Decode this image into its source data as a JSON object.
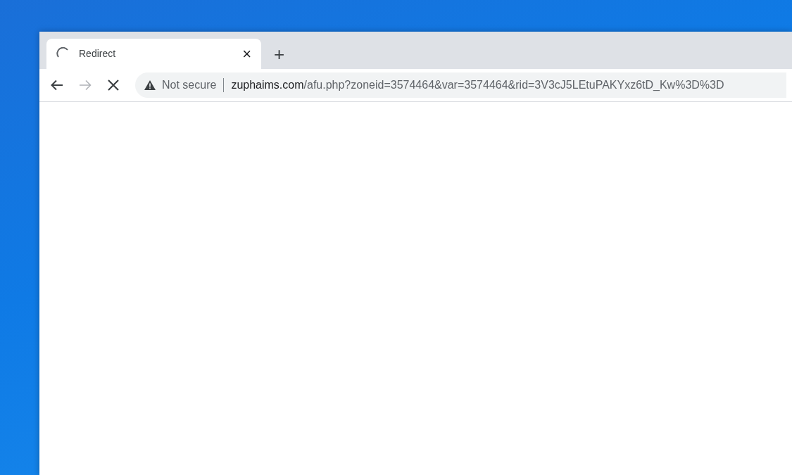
{
  "tabs": [
    {
      "title": "Redirect",
      "selected": true,
      "loading": true,
      "close": "×"
    }
  ],
  "new_tab": "+",
  "toolbar": {
    "back_disabled": false,
    "forward_disabled": true,
    "loading": true
  },
  "address_bar": {
    "security": "Not secure",
    "url_host": "zuphaims.com",
    "url_path": "/afu.php?zoneid=3574464&var=3574464&rid=3V3cJ5LEtuPAKYxz6tD_Kw%3D%3D"
  }
}
